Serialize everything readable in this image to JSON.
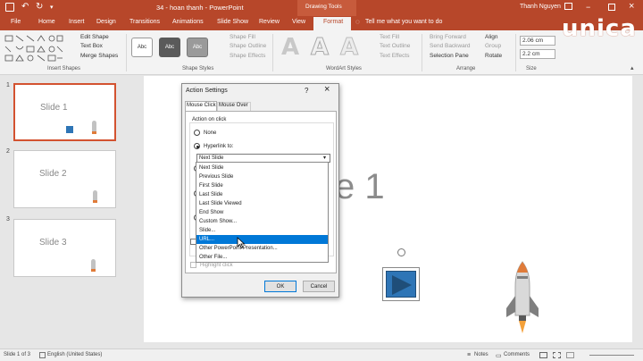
{
  "title_bar": {
    "doc_title": "34 - hoan thanh - PowerPoint",
    "context_group": "Drawing Tools",
    "user": "Thanh Nguyen",
    "brand": "unica"
  },
  "tabs": [
    {
      "label": "File"
    },
    {
      "label": "Home"
    },
    {
      "label": "Insert"
    },
    {
      "label": "Design"
    },
    {
      "label": "Transitions"
    },
    {
      "label": "Animations"
    },
    {
      "label": "Slide Show"
    },
    {
      "label": "Review"
    },
    {
      "label": "View"
    },
    {
      "label": "Format",
      "active": true
    }
  ],
  "tell_me": "Tell me what you want to do",
  "ribbon": {
    "insert_shapes": {
      "edit_shape": "Edit Shape",
      "text_box": "Text Box",
      "merge_shapes": "Merge Shapes",
      "label": "Insert Shapes"
    },
    "shape_styles": {
      "samples": [
        "Abc",
        "Abc",
        "Abc"
      ],
      "fill": "Shape Fill",
      "outline": "Shape Outline",
      "effects": "Shape Effects",
      "label": "Shape Styles"
    },
    "wordart": {
      "glyph": "A",
      "text_fill": "Text Fill",
      "text_outline": "Text Outline",
      "text_effects": "Text Effects",
      "label": "WordArt Styles"
    },
    "arrange": {
      "bring_forward": "Bring Forward",
      "send_backward": "Send Backward",
      "selection_pane": "Selection Pane",
      "align": "Align",
      "group": "Group",
      "rotate": "Rotate",
      "label": "Arrange"
    },
    "size": {
      "height": "2.06 cm",
      "width": "2.2 cm",
      "label": "Size"
    }
  },
  "thumbnails": [
    {
      "num": "1",
      "title": "Slide 1",
      "selected": true
    },
    {
      "num": "2",
      "title": "Slide 2",
      "selected": false
    },
    {
      "num": "3",
      "title": "Slide 3",
      "selected": false
    }
  ],
  "slide": {
    "title_fragment": "e 1"
  },
  "dialog": {
    "title": "Action Settings",
    "help": "?",
    "close": "×",
    "tabs": [
      "Mouse Click",
      "Mouse Over"
    ],
    "action_label": "Action on click",
    "opt_none": "None",
    "opt_hyperlink": "Hyperlink to:",
    "dropdown_value": "Next Slide",
    "highlight_click": "Highlight click",
    "ok": "OK",
    "cancel": "Cancel"
  },
  "dropdown_items": [
    {
      "label": "Next Slide"
    },
    {
      "label": "Previous Slide"
    },
    {
      "label": "First Slide"
    },
    {
      "label": "Last Slide"
    },
    {
      "label": "Last Slide Viewed"
    },
    {
      "label": "End Show"
    },
    {
      "label": "Custom Show..."
    },
    {
      "label": "Slide..."
    },
    {
      "label": "URL...",
      "selected": true
    },
    {
      "label": "Other PowerPoint Presentation..."
    },
    {
      "label": "Other File..."
    }
  ],
  "status": {
    "slide_info": "Slide 1 of 3",
    "language": "English (United States)",
    "notes": "Notes",
    "comments": "Comments"
  },
  "colors": {
    "accent": "#b7472a",
    "selection": "#0078d7",
    "action_button": "#2e75b6"
  }
}
